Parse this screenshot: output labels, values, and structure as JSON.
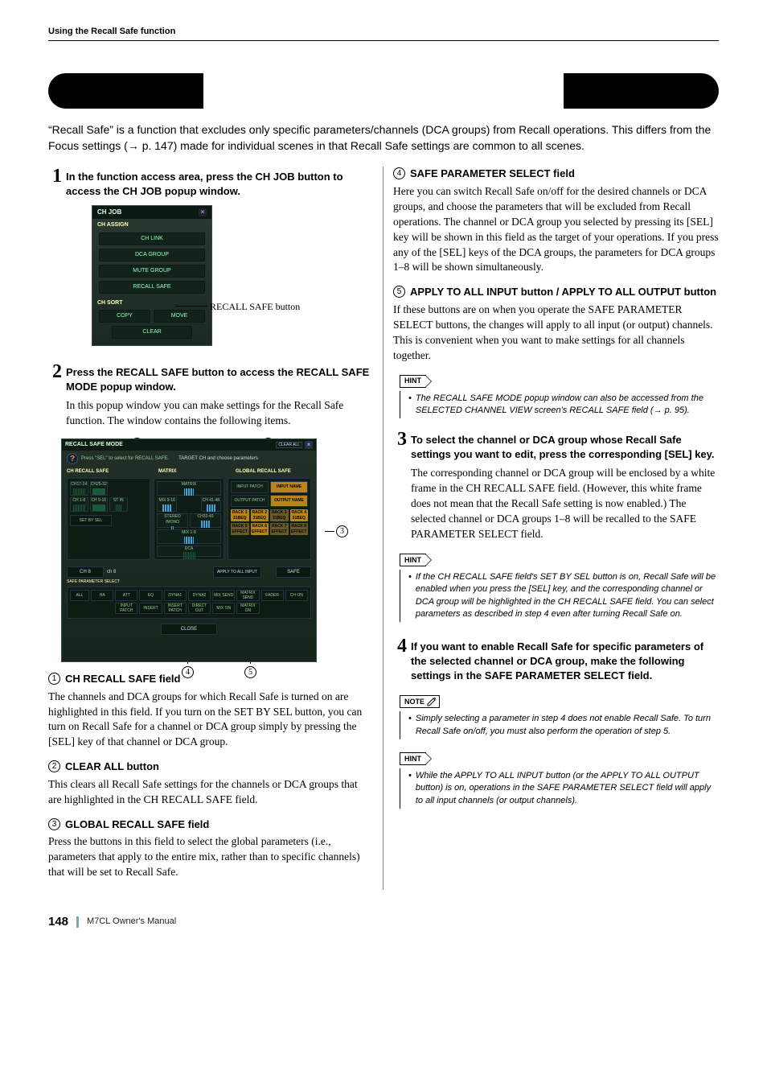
{
  "running_head": "Using the Recall Safe function",
  "title": "Using the Recall Safe function",
  "lead": "“Recall Safe” is a function that excludes only specific parameters/channels (DCA groups) from Recall operations. This differs from the Focus settings (→ p. 147) made for individual scenes in that Recall Safe settings are common to all scenes.",
  "left": {
    "step1_num": "1",
    "step1_head": "In the function access area, press the CH JOB button to access the CH JOB popup window.",
    "chjob": {
      "title": "CH JOB",
      "assign_label": "CH ASSIGN",
      "ch_link": "CH LINK",
      "dca_group": "DCA GROUP",
      "mute_group": "MUTE GROUP",
      "recall_safe": "RECALL SAFE",
      "sort_label": "CH SORT",
      "copy": "COPY",
      "move": "MOVE",
      "clear": "CLEAR",
      "callout": "RECALL SAFE button"
    },
    "step2_num": "2",
    "step2_head": "Press the RECALL SAFE button to access the RECALL SAFE MODE popup window.",
    "step2_body": "In this popup window you can make settings for the Recall Safe function. The window contains the following items.",
    "rsm": {
      "title": "RECALL SAFE MODE",
      "clear_all": "CLEAR ALL",
      "hint": "Press \"SEL\" to select for RECALL SAFE.",
      "target": "TARGET CH and choose parameters",
      "col1": "CH RECALL SAFE",
      "col2": "MATRIX",
      "col3": "GLOBAL RECALL SAFE",
      "ch": [
        "CH17-24",
        "CH25-32",
        "CH 1-8",
        "CH 9-16",
        "ST IN"
      ],
      "mx": [
        "MATRIX",
        "MIX 9-16",
        "CH 41-48",
        "STEREO /MONO",
        "CH33-40",
        "MIX 1-8",
        "DCA"
      ],
      "set_by_sel": "SET BY SEL",
      "g": {
        "ip": "INPUT PATCH",
        "in": "INPUT NAME",
        "op": "OUTPUT PATCH",
        "on": "OUTPUT NAME"
      },
      "racks": [
        "RACK 1 31BEQ",
        "RACK 2 31BEQ",
        "RACK 3 31BEQ",
        "RACK 4 31BEQ",
        "RACK 5 EFFECT",
        "RACK 6 EFFECT",
        "RACK 7 EFFECT",
        "RACK 8 EFFECT"
      ],
      "strip_ch": "CH 8",
      "strip_chn": "ch 8",
      "apply_all": "APPLY TO ALL INPUT",
      "safe": "SAFE",
      "sps_label": "SAFE PARAMETER SELECT",
      "sps_row1": [
        "ALL",
        "HA",
        "ATT",
        "EQ",
        "DYNA1",
        "DYNA2",
        "MIX SEND",
        "MATRIX SEND",
        "FADER",
        "CH ON"
      ],
      "sps_row2": [
        "INPUT PATCH",
        "INSERT",
        "INSERT PATCH",
        "DIRECT OUT",
        "MIX ON",
        "MATRIX ON"
      ],
      "close": "CLOSE"
    },
    "callouts": {
      "c1": "1",
      "c2": "2",
      "c3": "3",
      "c4": "4",
      "c5": "5"
    },
    "sec1_num": "1",
    "sec1_head": "CH RECALL SAFE field",
    "sec1_body": "The channels and DCA groups for which Recall Safe is turned on are highlighted in this field. If you turn on the SET BY SEL button, you can turn on Recall Safe for a channel or DCA group simply by pressing the [SEL] key of that channel or DCA group.",
    "sec2_num": "2",
    "sec2_head": "CLEAR ALL button",
    "sec2_body": "This clears all Recall Safe settings for the channels or DCA groups that are highlighted in the CH RECALL SAFE field.",
    "sec3_num": "3",
    "sec3_head": "GLOBAL RECALL SAFE field",
    "sec3_body": "Press the buttons in this field to select the global parameters (i.e., parameters that apply to the entire mix, rather than to specific channels) that will be set to Recall Safe."
  },
  "right": {
    "sec4_num": "4",
    "sec4_head": "SAFE PARAMETER SELECT field",
    "sec4_body": "Here you can switch Recall Safe on/off for the desired channels or DCA groups, and choose the parameters that will be excluded from Recall operations. The channel or DCA group you selected by pressing its [SEL] key will be shown in this field as the target of your operations. If you press any of the [SEL] keys of the DCA groups, the parameters for DCA groups 1–8 will be shown simultaneously.",
    "sec5_num": "5",
    "sec5_head": "APPLY TO ALL INPUT button / APPLY TO ALL OUTPUT button",
    "sec5_body": "If these buttons are on when you operate the SAFE PARAMETER SELECT buttons, the changes will apply to all input (or output) channels. This is convenient when you want to make settings for all channels together.",
    "hint1_tag": "HINT",
    "hint1": "The RECALL SAFE MODE popup window can also be accessed from the SELECTED CHANNEL VIEW screen's RECALL SAFE field (→ p. 95).",
    "step3_num": "3",
    "step3_head": "To select the channel or DCA group whose Recall Safe settings you want to edit, press the corresponding [SEL] key.",
    "step3_body": "The corresponding channel or DCA group will be enclosed by a white frame in the CH RECALL SAFE field. (However, this white frame does not mean that the Recall Safe setting is now enabled.) The selected channel or DCA groups 1–8 will be recalled to the SAFE PARAMETER SELECT field.",
    "hint2_tag": "HINT",
    "hint2": "If the CH RECALL SAFE field's SET BY SEL button is on, Recall Safe will be enabled when you press the [SEL] key, and the corresponding channel or DCA group will be highlighted in the CH RECALL SAFE field. You can select parameters as described in step 4 even after turning Recall Safe on.",
    "step4_num": "4",
    "step4_head": "If you want to enable Recall Safe for specific parameters of the selected channel or DCA group, make the following settings in the SAFE PARAMETER SELECT field.",
    "note_tag": "NOTE",
    "note1": "Simply selecting a parameter in step 4 does not enable Recall Safe. To turn Recall Safe on/off, you must also perform the operation of step 5.",
    "hint3_tag": "HINT",
    "hint3": "While the APPLY TO ALL INPUT button (or the APPLY TO ALL OUTPUT button) is on, operations in the SAFE PARAMETER SELECT field will apply to all input channels (or output channels)."
  },
  "footer": {
    "page": "148",
    "manual": "M7CL  Owner's Manual"
  }
}
